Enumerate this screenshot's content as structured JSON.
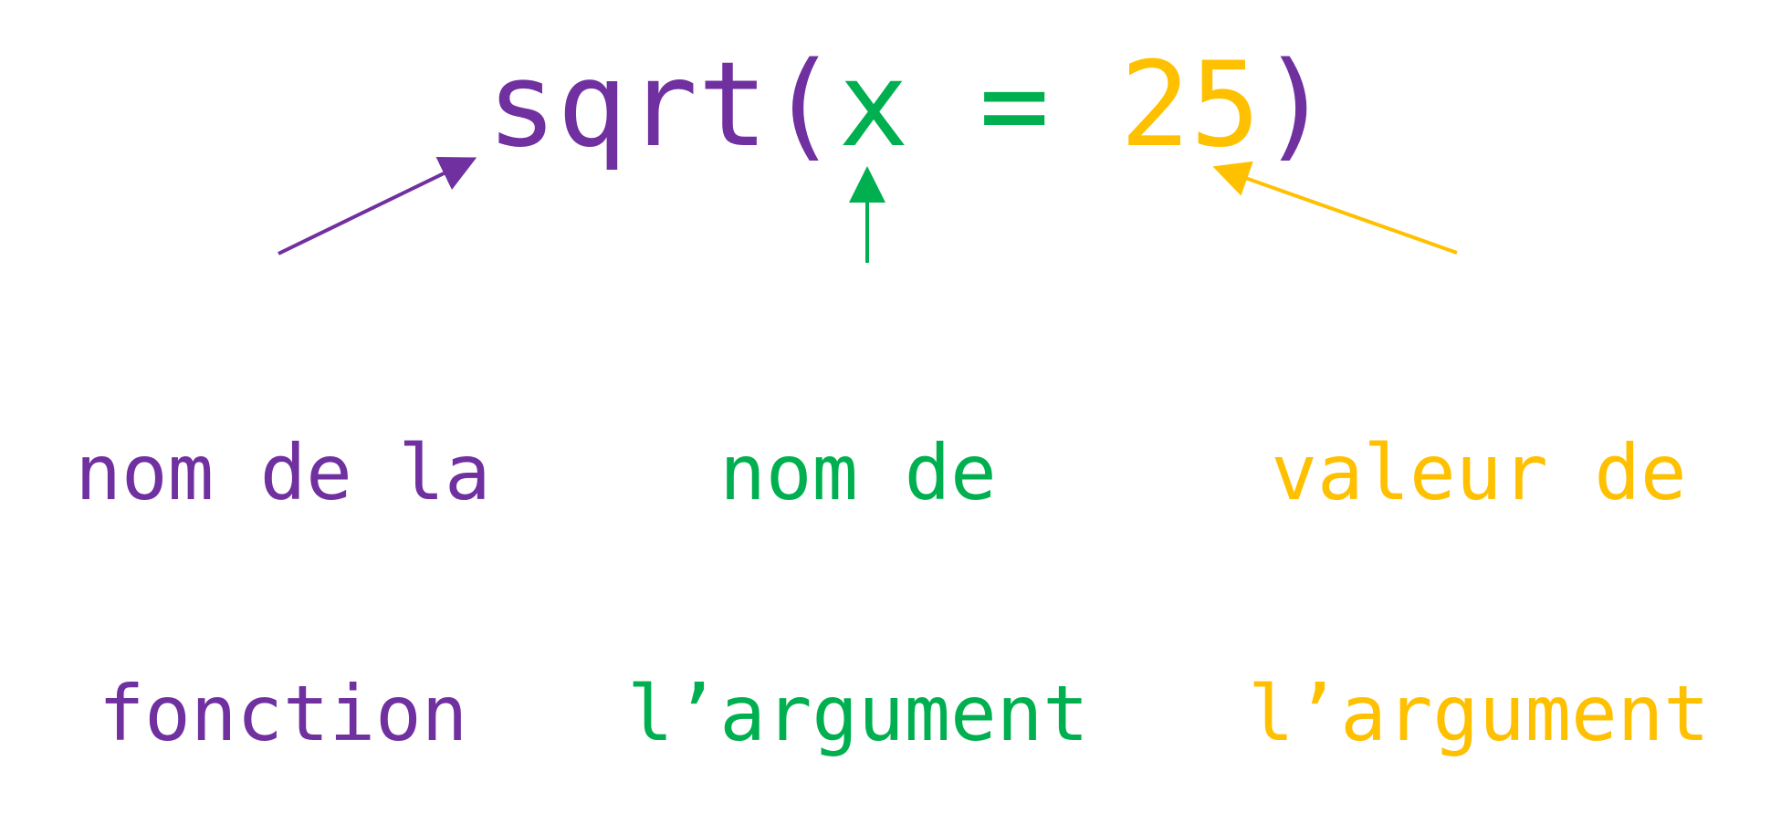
{
  "colors": {
    "function": "#7030a0",
    "argument_name": "#00b050",
    "argument_value": "#ffc000"
  },
  "code": {
    "function_name": "sqrt",
    "open_paren": "(",
    "argument_name": "x",
    "equals": " = ",
    "argument_value": "25",
    "close_paren": ")"
  },
  "labels": {
    "function_name": [
      "nom de la",
      "fonction"
    ],
    "argument_name": [
      "nom de",
      "l’argument"
    ],
    "argument_value": [
      "valeur de",
      "l’argument"
    ]
  }
}
